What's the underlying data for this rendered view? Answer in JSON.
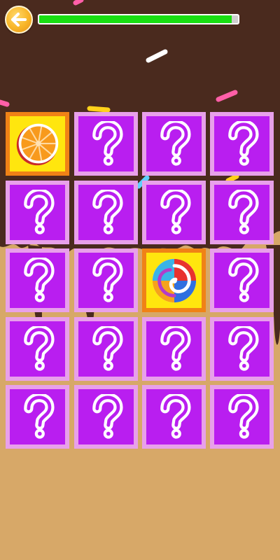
{
  "header": {
    "back_icon": "back-arrow-icon",
    "progress": 0.97,
    "progress_color": "#19df12"
  },
  "board": {
    "rows": 5,
    "cols": 4,
    "hidden_icon": "question-mark-icon",
    "colors": {
      "hidden_border": "#e8a0ea",
      "hidden_face": "#b91ef0",
      "revealed_border": "#f08216",
      "revealed_face": "#ffe60e"
    },
    "cards": [
      {
        "state": "revealed",
        "icon": "orange-slice-icon"
      },
      {
        "state": "hidden",
        "icon": "question-mark-icon"
      },
      {
        "state": "hidden",
        "icon": "question-mark-icon"
      },
      {
        "state": "hidden",
        "icon": "question-mark-icon"
      },
      {
        "state": "hidden",
        "icon": "question-mark-icon"
      },
      {
        "state": "hidden",
        "icon": "question-mark-icon"
      },
      {
        "state": "hidden",
        "icon": "question-mark-icon"
      },
      {
        "state": "hidden",
        "icon": "question-mark-icon"
      },
      {
        "state": "hidden",
        "icon": "question-mark-icon"
      },
      {
        "state": "hidden",
        "icon": "question-mark-icon"
      },
      {
        "state": "revealed",
        "icon": "swirl-lollipop-icon"
      },
      {
        "state": "hidden",
        "icon": "question-mark-icon"
      },
      {
        "state": "hidden",
        "icon": "question-mark-icon"
      },
      {
        "state": "hidden",
        "icon": "question-mark-icon"
      },
      {
        "state": "hidden",
        "icon": "question-mark-icon"
      },
      {
        "state": "hidden",
        "icon": "question-mark-icon"
      },
      {
        "state": "hidden",
        "icon": "question-mark-icon"
      },
      {
        "state": "hidden",
        "icon": "question-mark-icon"
      },
      {
        "state": "hidden",
        "icon": "question-mark-icon"
      },
      {
        "state": "hidden",
        "icon": "question-mark-icon"
      }
    ]
  },
  "background": {
    "chocolate_color": "#4a2a1e",
    "biscuit_color": "#d7a868",
    "sprinkle_colors": [
      "#ffffff",
      "#ff5fa8",
      "#ffd21a",
      "#5fd0ff"
    ]
  }
}
